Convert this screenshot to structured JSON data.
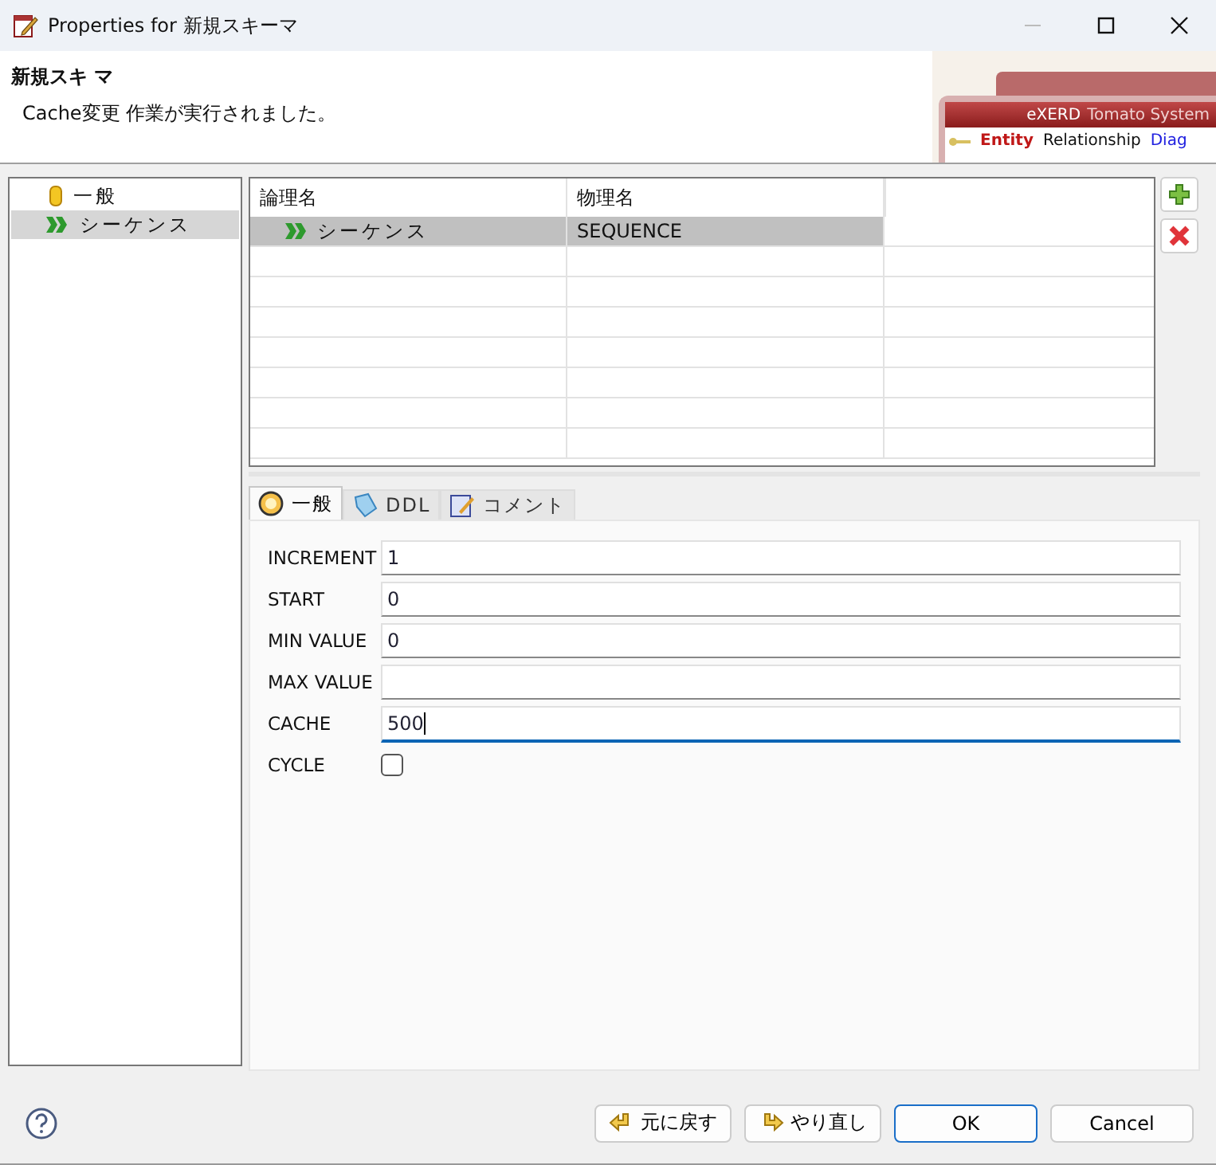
{
  "window": {
    "title": "Properties for 新規スキーマ"
  },
  "header": {
    "title": "新規スキ マ",
    "message": "Cache変更 作業が実行されました。",
    "banner": {
      "title": "eXERD",
      "subtitle": "Tomato System",
      "tabs": [
        "Entity",
        "Relationship",
        "Diag"
      ]
    }
  },
  "tree": {
    "items": [
      {
        "label": "一般",
        "selected": false
      },
      {
        "label": "シーケンス",
        "selected": true
      }
    ]
  },
  "table": {
    "columns": [
      "論理名",
      "物理名"
    ],
    "rows": [
      {
        "cells": [
          "シーケンス",
          "SEQUENCE"
        ],
        "selected": true
      }
    ]
  },
  "tabs": [
    {
      "label": "一般",
      "selected": true
    },
    {
      "label": "DDL",
      "selected": false
    },
    {
      "label": "コメント",
      "selected": false
    }
  ],
  "fields": [
    {
      "kind": "text",
      "label": "INCREMENT",
      "value": "1",
      "focused": false
    },
    {
      "kind": "text",
      "label": "START",
      "value": "0",
      "focused": false
    },
    {
      "kind": "text",
      "label": "MIN VALUE",
      "value": "0",
      "focused": false
    },
    {
      "kind": "text",
      "label": "MAX VALUE",
      "focused": false
    },
    {
      "kind": "text",
      "label": "CACHE",
      "value": "500",
      "focused": true
    },
    {
      "kind": "checkbox",
      "label": "CYCLE",
      "checked": false
    }
  ],
  "buttons": [
    {
      "label": "元に戻す",
      "kind": "undo"
    },
    {
      "label": "やり直し",
      "kind": "redo"
    },
    {
      "label": "OK",
      "kind": "default"
    },
    {
      "label": "Cancel",
      "kind": "plain"
    }
  ]
}
